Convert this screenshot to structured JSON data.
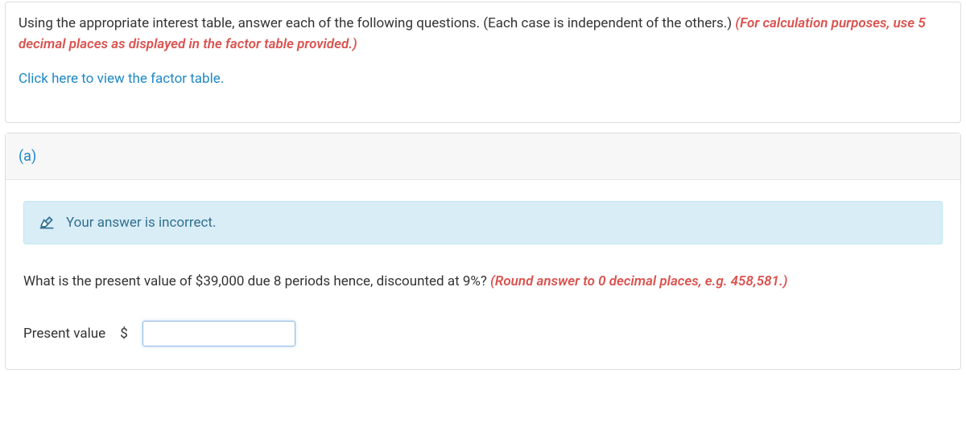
{
  "instruction": {
    "main_text": "Using the appropriate interest table, answer each of the following questions. (Each case is independent of the others.) ",
    "red_text": "(For calculation purposes, use 5 decimal places as displayed in the factor table provided.)",
    "link_text": "Click here to view the factor table."
  },
  "question": {
    "header_label": "(a)",
    "alert_text": "Your answer is incorrect.",
    "body_text": "What is the present value of $39,000 due 8 periods hence, discounted at 9%? ",
    "body_hint_red": "(Round answer to 0 decimal places, e.g. 458,581.)",
    "answer_label": "Present value",
    "currency_symbol": "$",
    "input_value": ""
  }
}
